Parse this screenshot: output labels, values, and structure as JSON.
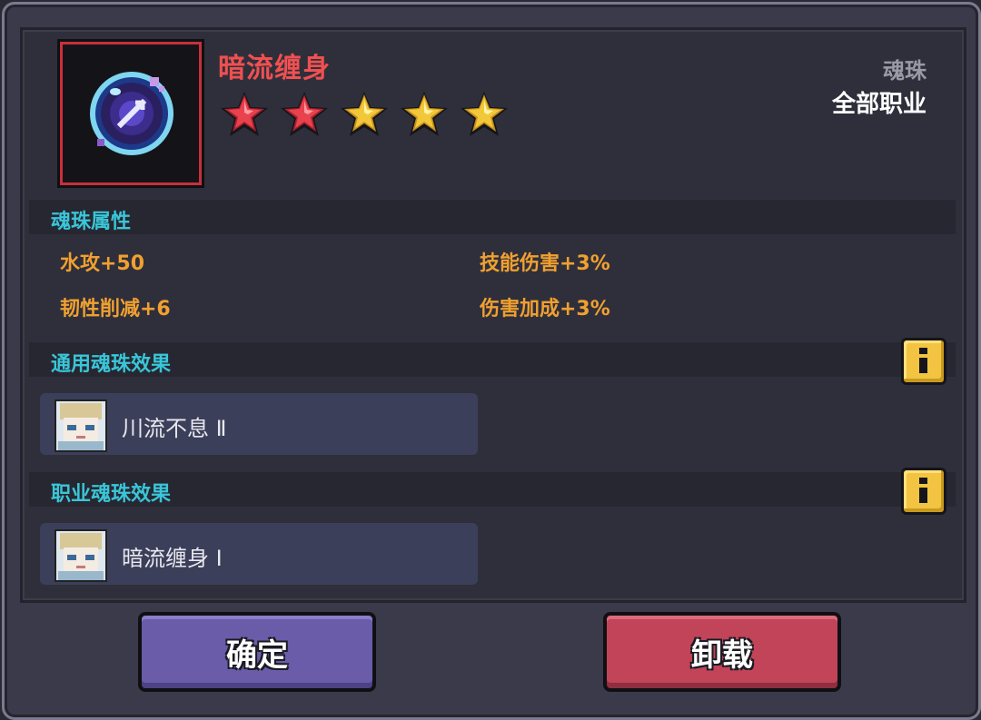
{
  "item": {
    "name": "暗流缠身",
    "type": "魂珠",
    "class_restriction": "全部职业",
    "star_rating": 5,
    "star_colors": [
      "#e8424e",
      "#e8424e",
      "#f2c83a",
      "#f2c83a",
      "#f2c83a"
    ],
    "icon": "soul-orb-icon"
  },
  "attributes": {
    "title": "魂珠属性",
    "items": [
      "水攻+50",
      "技能伤害+3%",
      "韧性削减+6",
      "伤害加成+3%"
    ]
  },
  "general_effects": {
    "title": "通用魂珠效果",
    "items": [
      {
        "label": "川流不息 Ⅱ",
        "icon": "character-avatar-icon"
      }
    ]
  },
  "class_effects": {
    "title": "职业魂珠效果",
    "items": [
      {
        "label": "暗流缠身 Ⅰ",
        "icon": "character-avatar-icon"
      }
    ]
  },
  "buttons": {
    "confirm": "确定",
    "unload": "卸载"
  },
  "colors": {
    "name": "#f05050",
    "section_title": "#39c6d8",
    "attribute": "#f0a030",
    "confirm_button": "#6a5ca8",
    "unload_button": "#c14458"
  }
}
